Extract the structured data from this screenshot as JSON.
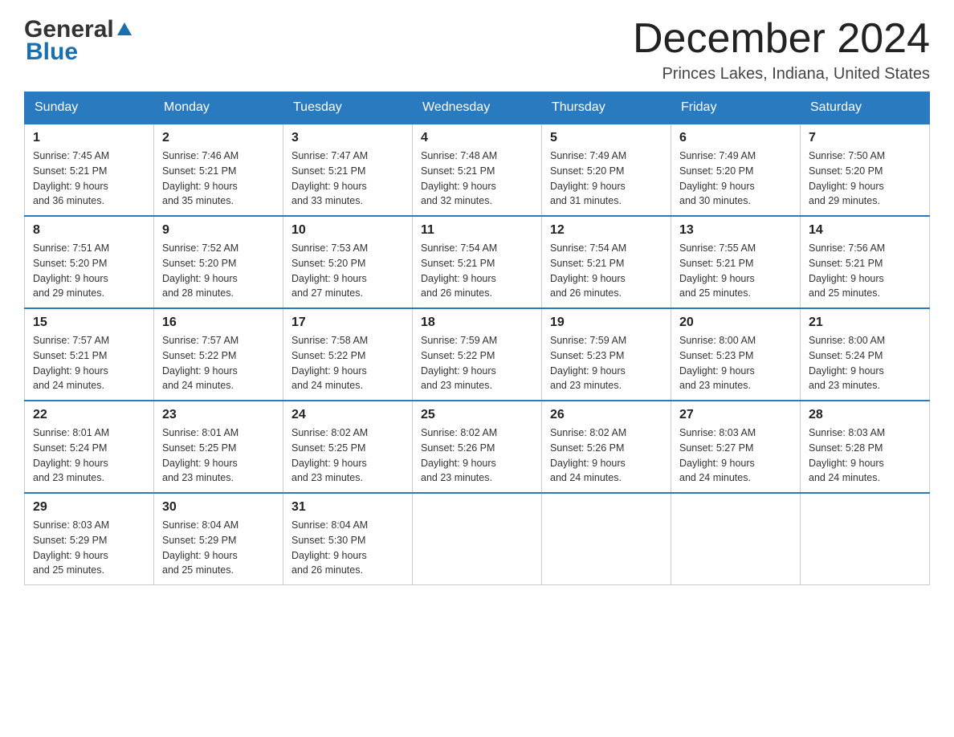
{
  "header": {
    "logo_general": "General",
    "logo_blue": "Blue",
    "month_title": "December 2024",
    "location": "Princes Lakes, Indiana, United States"
  },
  "days_of_week": [
    "Sunday",
    "Monday",
    "Tuesday",
    "Wednesday",
    "Thursday",
    "Friday",
    "Saturday"
  ],
  "weeks": [
    [
      {
        "day": "1",
        "sunrise": "Sunrise: 7:45 AM",
        "sunset": "Sunset: 5:21 PM",
        "daylight": "Daylight: 9 hours",
        "daylight2": "and 36 minutes."
      },
      {
        "day": "2",
        "sunrise": "Sunrise: 7:46 AM",
        "sunset": "Sunset: 5:21 PM",
        "daylight": "Daylight: 9 hours",
        "daylight2": "and 35 minutes."
      },
      {
        "day": "3",
        "sunrise": "Sunrise: 7:47 AM",
        "sunset": "Sunset: 5:21 PM",
        "daylight": "Daylight: 9 hours",
        "daylight2": "and 33 minutes."
      },
      {
        "day": "4",
        "sunrise": "Sunrise: 7:48 AM",
        "sunset": "Sunset: 5:21 PM",
        "daylight": "Daylight: 9 hours",
        "daylight2": "and 32 minutes."
      },
      {
        "day": "5",
        "sunrise": "Sunrise: 7:49 AM",
        "sunset": "Sunset: 5:20 PM",
        "daylight": "Daylight: 9 hours",
        "daylight2": "and 31 minutes."
      },
      {
        "day": "6",
        "sunrise": "Sunrise: 7:49 AM",
        "sunset": "Sunset: 5:20 PM",
        "daylight": "Daylight: 9 hours",
        "daylight2": "and 30 minutes."
      },
      {
        "day": "7",
        "sunrise": "Sunrise: 7:50 AM",
        "sunset": "Sunset: 5:20 PM",
        "daylight": "Daylight: 9 hours",
        "daylight2": "and 29 minutes."
      }
    ],
    [
      {
        "day": "8",
        "sunrise": "Sunrise: 7:51 AM",
        "sunset": "Sunset: 5:20 PM",
        "daylight": "Daylight: 9 hours",
        "daylight2": "and 29 minutes."
      },
      {
        "day": "9",
        "sunrise": "Sunrise: 7:52 AM",
        "sunset": "Sunset: 5:20 PM",
        "daylight": "Daylight: 9 hours",
        "daylight2": "and 28 minutes."
      },
      {
        "day": "10",
        "sunrise": "Sunrise: 7:53 AM",
        "sunset": "Sunset: 5:20 PM",
        "daylight": "Daylight: 9 hours",
        "daylight2": "and 27 minutes."
      },
      {
        "day": "11",
        "sunrise": "Sunrise: 7:54 AM",
        "sunset": "Sunset: 5:21 PM",
        "daylight": "Daylight: 9 hours",
        "daylight2": "and 26 minutes."
      },
      {
        "day": "12",
        "sunrise": "Sunrise: 7:54 AM",
        "sunset": "Sunset: 5:21 PM",
        "daylight": "Daylight: 9 hours",
        "daylight2": "and 26 minutes."
      },
      {
        "day": "13",
        "sunrise": "Sunrise: 7:55 AM",
        "sunset": "Sunset: 5:21 PM",
        "daylight": "Daylight: 9 hours",
        "daylight2": "and 25 minutes."
      },
      {
        "day": "14",
        "sunrise": "Sunrise: 7:56 AM",
        "sunset": "Sunset: 5:21 PM",
        "daylight": "Daylight: 9 hours",
        "daylight2": "and 25 minutes."
      }
    ],
    [
      {
        "day": "15",
        "sunrise": "Sunrise: 7:57 AM",
        "sunset": "Sunset: 5:21 PM",
        "daylight": "Daylight: 9 hours",
        "daylight2": "and 24 minutes."
      },
      {
        "day": "16",
        "sunrise": "Sunrise: 7:57 AM",
        "sunset": "Sunset: 5:22 PM",
        "daylight": "Daylight: 9 hours",
        "daylight2": "and 24 minutes."
      },
      {
        "day": "17",
        "sunrise": "Sunrise: 7:58 AM",
        "sunset": "Sunset: 5:22 PM",
        "daylight": "Daylight: 9 hours",
        "daylight2": "and 24 minutes."
      },
      {
        "day": "18",
        "sunrise": "Sunrise: 7:59 AM",
        "sunset": "Sunset: 5:22 PM",
        "daylight": "Daylight: 9 hours",
        "daylight2": "and 23 minutes."
      },
      {
        "day": "19",
        "sunrise": "Sunrise: 7:59 AM",
        "sunset": "Sunset: 5:23 PM",
        "daylight": "Daylight: 9 hours",
        "daylight2": "and 23 minutes."
      },
      {
        "day": "20",
        "sunrise": "Sunrise: 8:00 AM",
        "sunset": "Sunset: 5:23 PM",
        "daylight": "Daylight: 9 hours",
        "daylight2": "and 23 minutes."
      },
      {
        "day": "21",
        "sunrise": "Sunrise: 8:00 AM",
        "sunset": "Sunset: 5:24 PM",
        "daylight": "Daylight: 9 hours",
        "daylight2": "and 23 minutes."
      }
    ],
    [
      {
        "day": "22",
        "sunrise": "Sunrise: 8:01 AM",
        "sunset": "Sunset: 5:24 PM",
        "daylight": "Daylight: 9 hours",
        "daylight2": "and 23 minutes."
      },
      {
        "day": "23",
        "sunrise": "Sunrise: 8:01 AM",
        "sunset": "Sunset: 5:25 PM",
        "daylight": "Daylight: 9 hours",
        "daylight2": "and 23 minutes."
      },
      {
        "day": "24",
        "sunrise": "Sunrise: 8:02 AM",
        "sunset": "Sunset: 5:25 PM",
        "daylight": "Daylight: 9 hours",
        "daylight2": "and 23 minutes."
      },
      {
        "day": "25",
        "sunrise": "Sunrise: 8:02 AM",
        "sunset": "Sunset: 5:26 PM",
        "daylight": "Daylight: 9 hours",
        "daylight2": "and 23 minutes."
      },
      {
        "day": "26",
        "sunrise": "Sunrise: 8:02 AM",
        "sunset": "Sunset: 5:26 PM",
        "daylight": "Daylight: 9 hours",
        "daylight2": "and 24 minutes."
      },
      {
        "day": "27",
        "sunrise": "Sunrise: 8:03 AM",
        "sunset": "Sunset: 5:27 PM",
        "daylight": "Daylight: 9 hours",
        "daylight2": "and 24 minutes."
      },
      {
        "day": "28",
        "sunrise": "Sunrise: 8:03 AM",
        "sunset": "Sunset: 5:28 PM",
        "daylight": "Daylight: 9 hours",
        "daylight2": "and 24 minutes."
      }
    ],
    [
      {
        "day": "29",
        "sunrise": "Sunrise: 8:03 AM",
        "sunset": "Sunset: 5:29 PM",
        "daylight": "Daylight: 9 hours",
        "daylight2": "and 25 minutes."
      },
      {
        "day": "30",
        "sunrise": "Sunrise: 8:04 AM",
        "sunset": "Sunset: 5:29 PM",
        "daylight": "Daylight: 9 hours",
        "daylight2": "and 25 minutes."
      },
      {
        "day": "31",
        "sunrise": "Sunrise: 8:04 AM",
        "sunset": "Sunset: 5:30 PM",
        "daylight": "Daylight: 9 hours",
        "daylight2": "and 26 minutes."
      },
      null,
      null,
      null,
      null
    ]
  ]
}
